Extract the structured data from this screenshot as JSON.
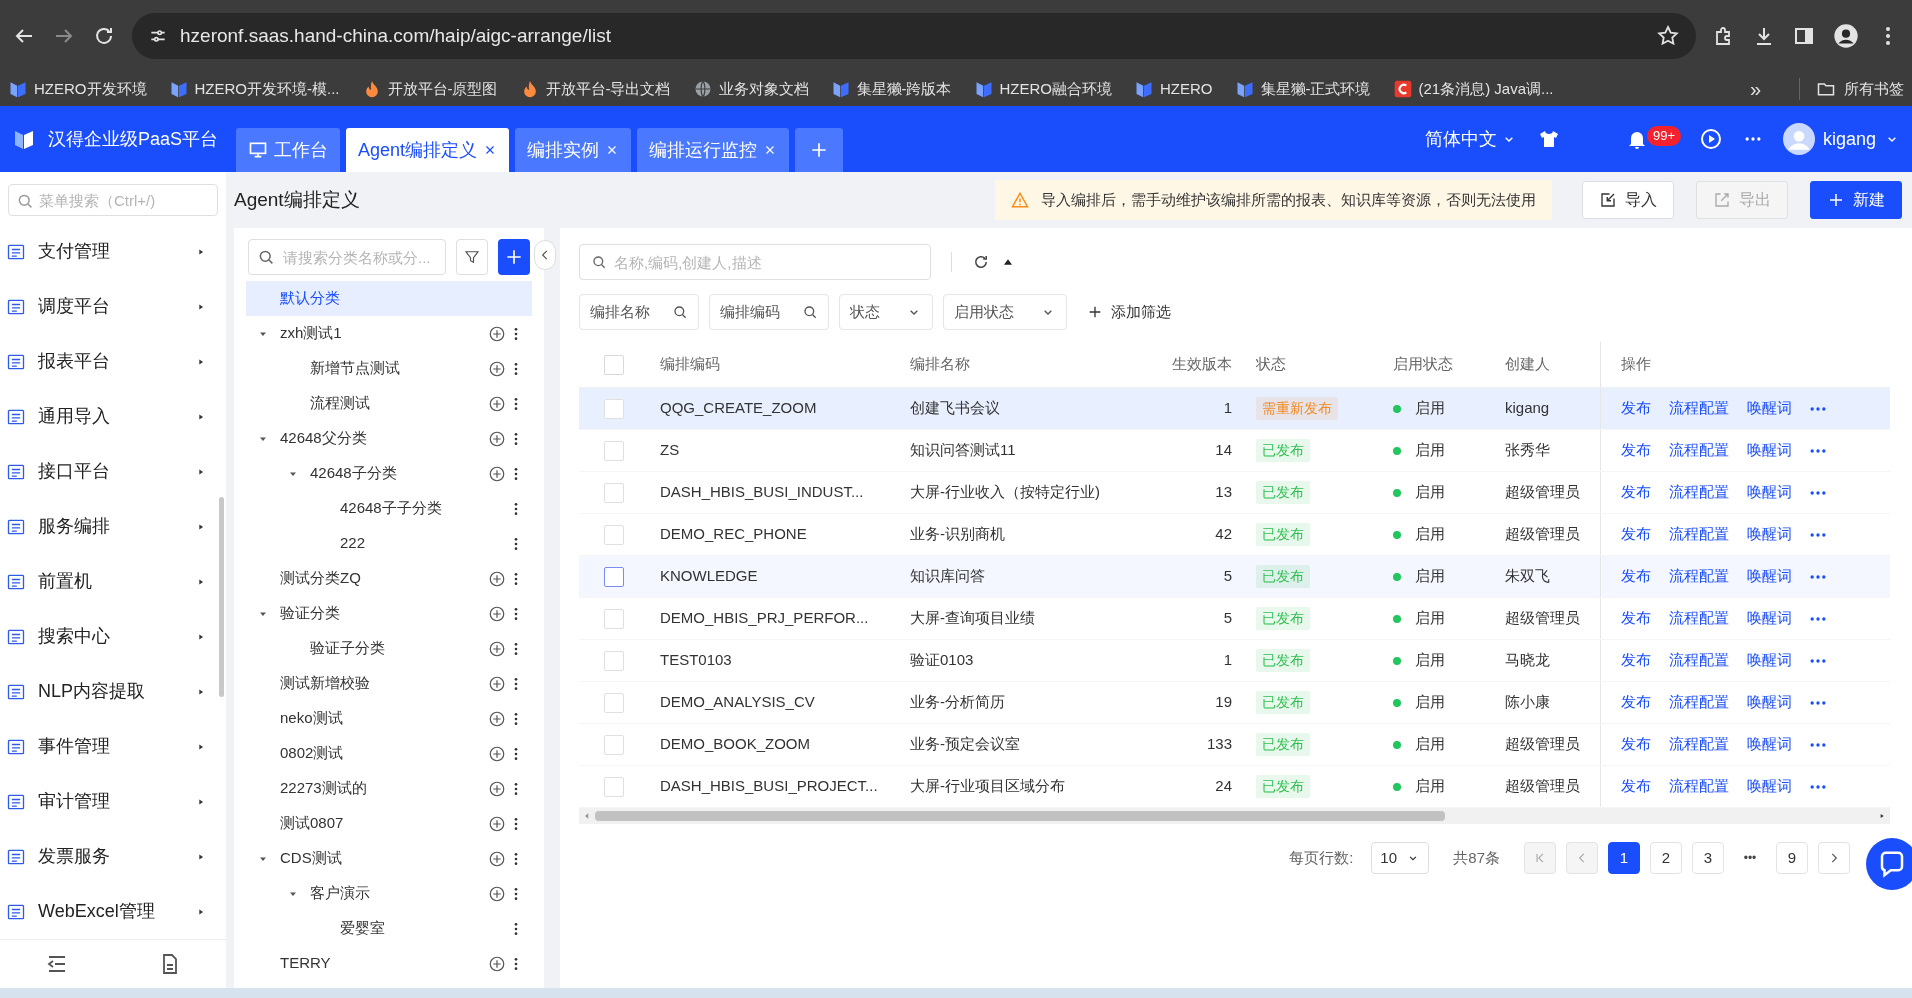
{
  "browser": {
    "url": "hzeronf.saas.hand-china.com/haip/aigc-arrange/list",
    "bookmarks": [
      {
        "label": "HZERO开发环境",
        "kind": "hzero"
      },
      {
        "label": "HZERO开发环境-模...",
        "kind": "hzero"
      },
      {
        "label": "开放平台-原型图",
        "kind": "fire"
      },
      {
        "label": "开放平台-导出文档",
        "kind": "fire"
      },
      {
        "label": "业务对象文档",
        "kind": "globe"
      },
      {
        "label": "集星獭-跨版本",
        "kind": "hzero"
      },
      {
        "label": "HZERO融合环境",
        "kind": "hzero"
      },
      {
        "label": "HZERO",
        "kind": "hzero"
      },
      {
        "label": "集星獭-正式环境",
        "kind": "hzero"
      },
      {
        "label": "(21条消息) Java调...",
        "kind": "csdn"
      }
    ],
    "more": "»",
    "all_bookmarks": "所有书签"
  },
  "app": {
    "title": "汉得企业级PaaS平台",
    "tabs": [
      {
        "label": "工作台",
        "selected": false,
        "kind": "home"
      },
      {
        "label": "Agent编排定义",
        "selected": true,
        "kind": "closable"
      },
      {
        "label": "编排实例",
        "selected": false,
        "kind": "closable"
      },
      {
        "label": "编排运行监控",
        "selected": false,
        "kind": "closable"
      }
    ],
    "language": "简体中文",
    "notification_count": "99+",
    "user": "kigang"
  },
  "sidebar": {
    "search_placeholder": "菜单搜索（Ctrl+/)",
    "items": [
      "支付管理",
      "调度平台",
      "报表平台",
      "通用导入",
      "接口平台",
      "服务编排",
      "前置机",
      "搜索中心",
      "NLP内容提取",
      "事件管理",
      "审计管理",
      "发票服务",
      "WebExcel管理"
    ]
  },
  "page": {
    "title": "Agent编排定义",
    "notice": "导入编排后，需手动维护该编排所需的报表、知识库等资源，否则无法使用",
    "buttons": [
      {
        "label": "导入",
        "kind": "default"
      },
      {
        "label": "导出",
        "kind": "disabled"
      },
      {
        "label": "新建",
        "kind": "primary"
      }
    ]
  },
  "categories": {
    "search_placeholder": "请搜索分类名称或分...",
    "items": [
      {
        "label": "默认分类",
        "selected": true,
        "addable": false
      },
      {
        "label": "zxh测试1",
        "selected": false,
        "addable": true,
        "expanded": true,
        "children": [
          {
            "label": "新增节点测试",
            "selected": false,
            "addable": true
          },
          {
            "label": "流程测试",
            "selected": false,
            "addable": true
          }
        ]
      },
      {
        "label": "42648父分类",
        "selected": false,
        "addable": true,
        "expanded": true,
        "children": [
          {
            "label": "42648子分类",
            "selected": false,
            "addable": true,
            "expanded": true,
            "children": [
              {
                "label": "42648子子分类",
                "selected": false,
                "addable": false
              },
              {
                "label": "222",
                "selected": false,
                "addable": false
              }
            ]
          }
        ]
      },
      {
        "label": "测试分类ZQ",
        "selected": false,
        "addable": true
      },
      {
        "label": "验证分类",
        "selected": false,
        "addable": true,
        "expanded": true,
        "children": [
          {
            "label": "验证子分类",
            "selected": false,
            "addable": true
          }
        ]
      },
      {
        "label": "测试新增校验",
        "selected": false,
        "addable": true
      },
      {
        "label": "neko测试",
        "selected": false,
        "addable": true
      },
      {
        "label": "0802测试",
        "selected": false,
        "addable": true
      },
      {
        "label": "22273测试的",
        "selected": false,
        "addable": true
      },
      {
        "label": "测试0807",
        "selected": false,
        "addable": true
      },
      {
        "label": "CDS测试",
        "selected": false,
        "addable": true,
        "expanded": true,
        "children": [
          {
            "label": "客户演示",
            "selected": false,
            "addable": true,
            "expanded": true,
            "children": [
              {
                "label": "爱婴室",
                "selected": false,
                "addable": false
              }
            ]
          }
        ]
      },
      {
        "label": "TERRY",
        "selected": false,
        "addable": true
      }
    ]
  },
  "table": {
    "search_placeholder": "名称,编码,创建人,描述",
    "filters": [
      {
        "label": "编排名称",
        "kind": "search"
      },
      {
        "label": "编排编码",
        "kind": "search"
      },
      {
        "label": "状态",
        "kind": "select"
      },
      {
        "label": "启用状态",
        "kind": "select"
      }
    ],
    "add_filter": "添加筛选",
    "all_checked": false,
    "columns": [
      "编排编码",
      "编排名称",
      "生效版本",
      "状态",
      "启用状态",
      "创建人",
      "操作"
    ],
    "rows": [
      {
        "code": "QQG_CREATE_ZOOM",
        "name": "创建飞书会议",
        "version": "1",
        "status": {
          "label": "需重新发布",
          "color": "#f08a24"
        },
        "enabled": "启用",
        "creator": "kigang",
        "actions": [
          "发布",
          "流程配置",
          "唤醒词"
        ],
        "checked": false,
        "selected": true,
        "hovered": false
      },
      {
        "code": "ZS",
        "name": "知识问答测试11",
        "version": "14",
        "status": {
          "label": "已发布",
          "color": "#2fbf4f"
        },
        "enabled": "启用",
        "creator": "张秀华",
        "actions": [
          "发布",
          "流程配置",
          "唤醒词"
        ],
        "checked": false,
        "selected": false,
        "hovered": false
      },
      {
        "code": "DASH_HBIS_BUSI_INDUST...",
        "name": "大屏-行业收入（按特定行业)",
        "version": "13",
        "status": {
          "label": "已发布",
          "color": "#2fbf4f"
        },
        "enabled": "启用",
        "creator": "超级管理员",
        "actions": [
          "发布",
          "流程配置",
          "唤醒词"
        ],
        "checked": false,
        "selected": false,
        "hovered": false
      },
      {
        "code": "DEMO_REC_PHONE",
        "name": "业务-识别商机",
        "version": "42",
        "status": {
          "label": "已发布",
          "color": "#2fbf4f"
        },
        "enabled": "启用",
        "creator": "超级管理员",
        "actions": [
          "发布",
          "流程配置",
          "唤醒词"
        ],
        "checked": false,
        "selected": false,
        "hovered": false
      },
      {
        "code": "KNOWLEDGE",
        "name": "知识库问答",
        "version": "5",
        "status": {
          "label": "已发布",
          "color": "#2fbf4f"
        },
        "enabled": "启用",
        "creator": "朱双飞",
        "actions": [
          "发布",
          "流程配置",
          "唤醒词"
        ],
        "checked": false,
        "selected": false,
        "hovered": true
      },
      {
        "code": "DEMO_HBIS_PRJ_PERFOR...",
        "name": "大屏-查询项目业绩",
        "version": "5",
        "status": {
          "label": "已发布",
          "color": "#2fbf4f"
        },
        "enabled": "启用",
        "creator": "超级管理员",
        "actions": [
          "发布",
          "流程配置",
          "唤醒词"
        ],
        "checked": false,
        "selected": false,
        "hovered": false
      },
      {
        "code": "TEST0103",
        "name": "验证0103",
        "version": "1",
        "status": {
          "label": "已发布",
          "color": "#2fbf4f"
        },
        "enabled": "启用",
        "creator": "马晓龙",
        "actions": [
          "发布",
          "流程配置",
          "唤醒词"
        ],
        "checked": false,
        "selected": false,
        "hovered": false
      },
      {
        "code": "DEMO_ANALYSIS_CV",
        "name": "业务-分析简历",
        "version": "19",
        "status": {
          "label": "已发布",
          "color": "#2fbf4f"
        },
        "enabled": "启用",
        "creator": "陈小康",
        "actions": [
          "发布",
          "流程配置",
          "唤醒词"
        ],
        "checked": false,
        "selected": false,
        "hovered": false
      },
      {
        "code": "DEMO_BOOK_ZOOM",
        "name": "业务-预定会议室",
        "version": "133",
        "status": {
          "label": "已发布",
          "color": "#2fbf4f"
        },
        "enabled": "启用",
        "creator": "超级管理员",
        "actions": [
          "发布",
          "流程配置",
          "唤醒词"
        ],
        "checked": false,
        "selected": false,
        "hovered": false
      },
      {
        "code": "DASH_HBIS_BUSI_PROJECT...",
        "name": "大屏-行业项目区域分布",
        "version": "24",
        "status": {
          "label": "已发布",
          "color": "#2fbf4f"
        },
        "enabled": "启用",
        "creator": "超级管理员",
        "actions": [
          "发布",
          "流程配置",
          "唤醒词"
        ],
        "checked": false,
        "selected": false,
        "hovered": false
      }
    ]
  },
  "pagination": {
    "rows_label": "每页行数:",
    "page_size": "10",
    "total": "共87条",
    "pages": [
      {
        "label": "1",
        "kind": "page",
        "selected": true
      },
      {
        "label": "2",
        "kind": "page",
        "selected": false
      },
      {
        "label": "3",
        "kind": "page",
        "selected": false
      },
      {
        "label": "•••",
        "kind": "ellipsis",
        "selected": false
      },
      {
        "label": "9",
        "kind": "page",
        "selected": false
      }
    ]
  }
}
